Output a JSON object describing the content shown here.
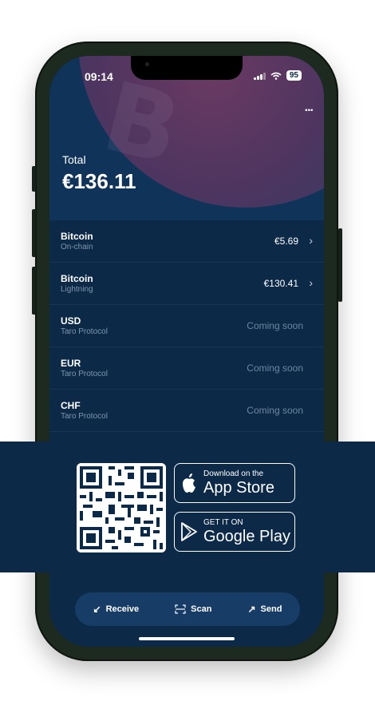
{
  "status_bar": {
    "time": "09:14",
    "battery": "95"
  },
  "header": {
    "more_label": "...",
    "total_label": "Total",
    "total_value": "€136.11"
  },
  "assets": [
    {
      "name": "Bitcoin",
      "sub": "On-chain",
      "value": "€5.69",
      "chevron": "›"
    },
    {
      "name": "Bitcoin",
      "sub": "Lightning",
      "value": "€130.41",
      "chevron": "›"
    },
    {
      "name": "USD",
      "sub": "Taro Protocol",
      "value": "Coming soon"
    },
    {
      "name": "EUR",
      "sub": "Taro Protocol",
      "value": "Coming soon"
    },
    {
      "name": "CHF",
      "sub": "Taro Protocol",
      "value": "Coming soon"
    }
  ],
  "actions": {
    "receive": "Receive",
    "scan": "Scan",
    "send": "Send"
  },
  "promo": {
    "app_store_top": "Download on the",
    "app_store_big": "App Store",
    "google_play_top": "GET IT ON",
    "google_play_big": "Google Play"
  },
  "colors": {
    "background": "#0c2948",
    "accent_orb": "#6a3a62"
  }
}
